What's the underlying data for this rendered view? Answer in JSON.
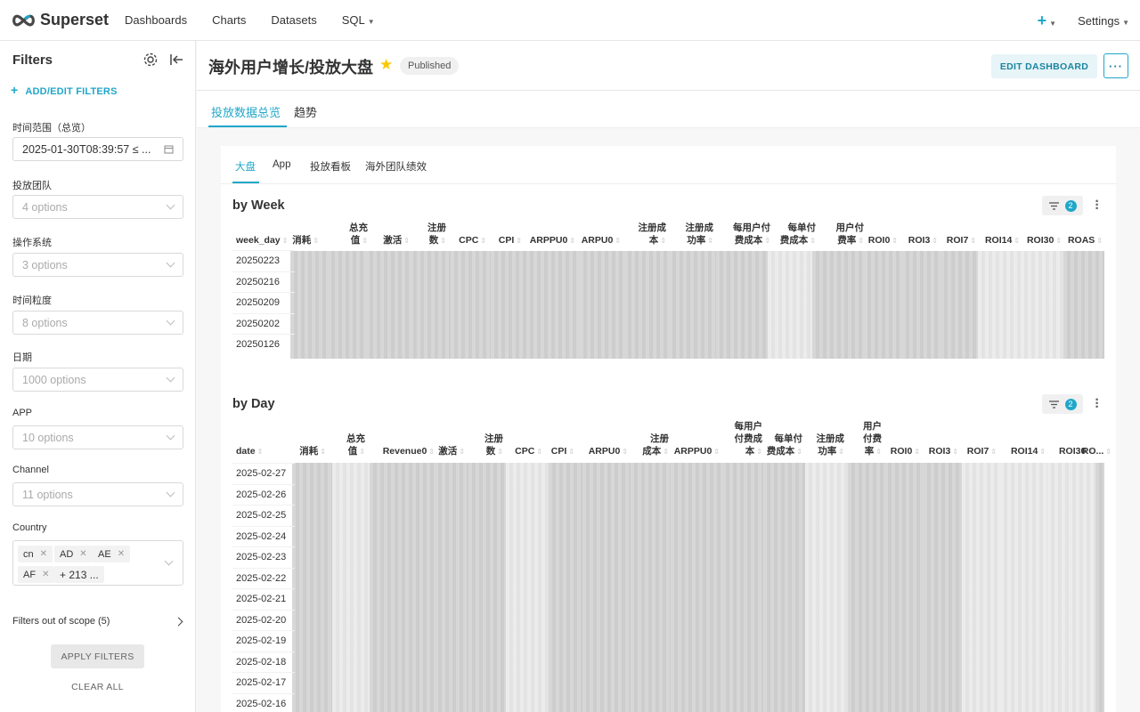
{
  "nav": {
    "logo": "Superset",
    "items": [
      "Dashboards",
      "Charts",
      "Datasets",
      "SQL"
    ],
    "settings": "Settings"
  },
  "sidebar": {
    "title": "Filters",
    "add_filters": "ADD/EDIT FILTERS",
    "filters": [
      {
        "label": "时间范围（总览）",
        "value": "2025-01-30T08:39:57 ≤ ..."
      },
      {
        "label": "投放团队",
        "placeholder": "4 options"
      },
      {
        "label": "操作系统",
        "placeholder": "3 options"
      },
      {
        "label": "时间粒度",
        "placeholder": "8 options"
      },
      {
        "label": "日期",
        "placeholder": "1000 options"
      },
      {
        "label": "APP",
        "placeholder": "10 options"
      },
      {
        "label": "Channel",
        "placeholder": "11 options"
      }
    ],
    "country": {
      "label": "Country",
      "tags": [
        "cn",
        "AD",
        "AE",
        "AF"
      ],
      "more": "+ 213 ..."
    },
    "out_of_scope": "Filters out of scope (5)",
    "apply": "APPLY FILTERS",
    "clear": "CLEAR ALL"
  },
  "header": {
    "title": "海外用户增长/投放大盘",
    "status": "Published",
    "edit": "EDIT DASHBOARD",
    "more": "···"
  },
  "top_tabs": [
    "投放数据总览",
    "趋势"
  ],
  "sub_tabs": [
    "大盘",
    "App",
    "投放看板",
    "海外团队绩效"
  ],
  "by_week": {
    "title": "by Week",
    "filter_count": "2",
    "columns": [
      "week_day",
      "消耗",
      "总充\n值",
      "激活",
      "注册\n数",
      "CPC",
      "CPI",
      "ARPPU0",
      "ARPU0",
      "注册成\n本",
      "注册成\n功率",
      "每用户付\n费成本",
      "每单付\n费成本",
      "用户付\n费率",
      "ROI0",
      "ROI3",
      "ROI7",
      "ROI14",
      "ROI30",
      "ROAS"
    ],
    "rows": [
      "20250223",
      "20250216",
      "20250209",
      "20250202",
      "20250126"
    ]
  },
  "by_day": {
    "title": "by Day",
    "filter_count": "2",
    "columns": [
      "date",
      "消耗",
      "总充\n值",
      "Revenue0",
      "激活",
      "注册\n数",
      "CPC",
      "CPI",
      "ARPU0",
      "注册\n成本",
      "ARPPU0",
      "每用户\n付费成\n本",
      "每单付\n费成本",
      "注册成\n功率",
      "用户\n付费\n率",
      "ROI0",
      "ROI3",
      "ROI7",
      "ROI14",
      "ROI30",
      "RO..."
    ],
    "rows": [
      "2025-02-27",
      "2025-02-26",
      "2025-02-25",
      "2025-02-24",
      "2025-02-23",
      "2025-02-22",
      "2025-02-21",
      "2025-02-20",
      "2025-02-19",
      "2025-02-18",
      "2025-02-17",
      "2025-02-16"
    ]
  },
  "colors": {
    "accent": "#20a7c9",
    "star": "#fbc700"
  }
}
